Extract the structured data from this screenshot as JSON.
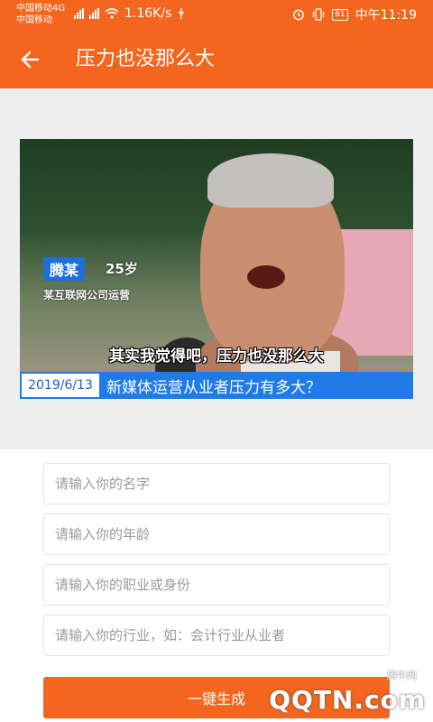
{
  "status_bar": {
    "carrier_1": "中国移动4G",
    "carrier_2": "中国移动",
    "network_speed": "1.16K/s",
    "battery": "61",
    "time": "中午11:19"
  },
  "app_bar": {
    "title": "压力也没那么大",
    "back_icon": "arrow-left-icon"
  },
  "photo": {
    "name_tag": "腾某",
    "age": "25岁",
    "job": "某互联网公司运营",
    "subtitle": "其实我觉得吧，压力也没那么大",
    "date": "2019/6/13",
    "headline": "新媒体运营从业者压力有多大？"
  },
  "form": {
    "name_placeholder": "请输入你的名字",
    "age_placeholder": "请输入你的年龄",
    "job_placeholder": "请输入你的职业或身份",
    "industry_placeholder": "请输入你的行业，如：会计行业从业者",
    "generate_label": "一键生成"
  },
  "watermark": {
    "small": "腾牛网",
    "brand": "QQTN.com"
  },
  "colors": {
    "accent": "#f4661e",
    "banner_blue": "#1e7be8"
  }
}
